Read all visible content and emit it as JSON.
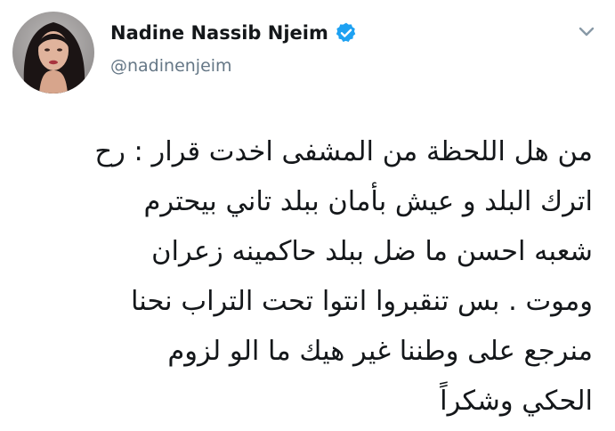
{
  "user": {
    "display_name": "Nadine Nassib Njeim",
    "handle": "@nadinenjeim",
    "verified": true,
    "avatar_icon": "profile-photo",
    "verified_icon": "verified-badge-icon"
  },
  "menu": {
    "icon": "chevron-down-icon"
  },
  "tweet": {
    "lines": [
      "من هل اللحظة من المشفى اخدت قرار : رح",
      "اترك البلد و عيش بأمان ببلد تاني بيحترم",
      "شعبه احسن ما ضل ببلد حاكمينه زعران",
      "وموت . بس تنقبروا انتوا تحت التراب نحنا",
      "منرجع على وطننا غير هيك ما الو لزوم",
      "الحكي وشكراً"
    ]
  },
  "colors": {
    "verified": "#1da1f2",
    "handle": "#657786",
    "text": "#14171a"
  }
}
